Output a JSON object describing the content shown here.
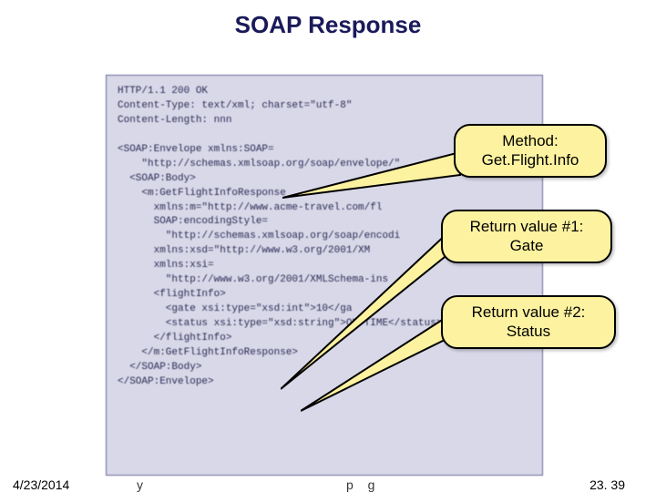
{
  "title": "SOAP Response",
  "code": "HTTP/1.1 200 OK\nContent-Type: text/xml; charset=\"utf-8\"\nContent-Length: nnn\n\n<SOAP:Envelope xmlns:SOAP=\n    \"http://schemas.xmlsoap.org/soap/envelope/\"\n  <SOAP:Body>\n    <m:GetFlightInfoResponse\n      xmlns:m=\"http://www.acme-travel.com/fl\n      SOAP:encodingStyle=\n        \"http://schemas.xmlsoap.org/soap/encodi\n      xmlns:xsd=\"http://www.w3.org/2001/XM\n      xmlns:xsi=\n        \"http://www.w3.org/2001/XMLSchema-ins\n      <flightInfo>\n        <gate xsi:type=\"xsd:int\">10</ga\n        <status xsi:type=\"xsd:string\">ON TIME</status>\n      </flightInfo>\n    </m:GetFlightInfoResponse>\n  </SOAP:Body>\n</SOAP:Envelope>",
  "callouts": {
    "method_label": "Method:",
    "method_value": "Get.Flight.Info",
    "r1_label": "Return value #1:",
    "r1_value": "Gate",
    "r2_label": "Return value #2:",
    "r2_value": "Status"
  },
  "footer": {
    "date": "4/23/2014",
    "mid_left": "y",
    "mid_right": "p   g",
    "page": "23. 39"
  }
}
